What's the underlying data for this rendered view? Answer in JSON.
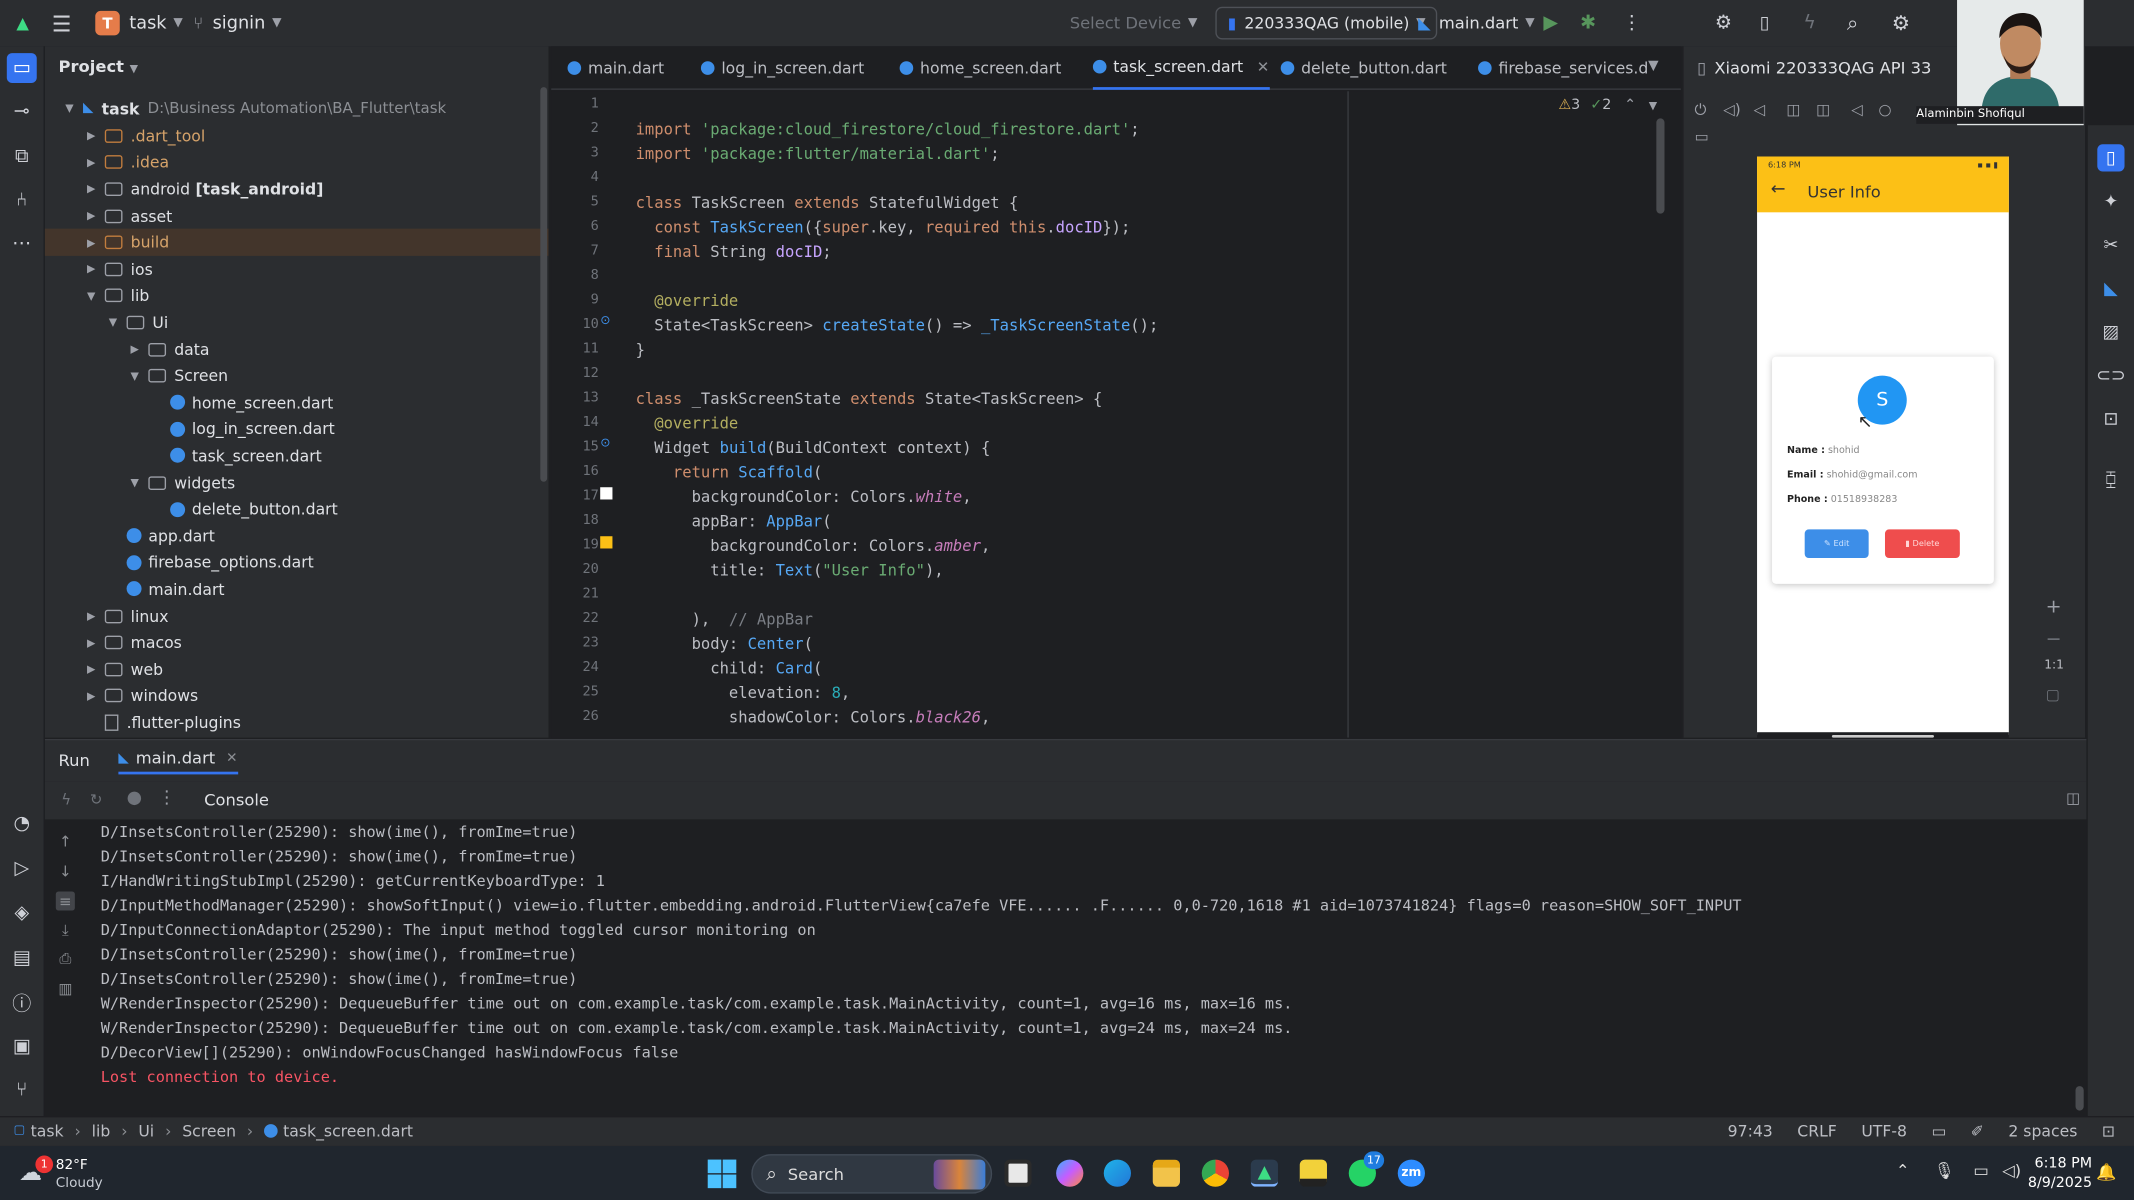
{
  "titlebar": {
    "project_letter": "T",
    "project_name": "task",
    "branch": "signin",
    "select_device": "Select Device",
    "device": "220333QAG (mobile)",
    "run_config": "main.dart"
  },
  "project_panel": {
    "title": "Project",
    "root_name": "task",
    "root_path": "D:\\Business Automation\\BA_Flutter\\task",
    "items": [
      {
        "label": ".dart_tool",
        "type": "folder-orange",
        "level": 1,
        "arrow": "right",
        "hl": false
      },
      {
        "label": ".idea",
        "type": "folder-orange",
        "level": 1,
        "arrow": "right",
        "hl": false
      },
      {
        "label": "android",
        "suffix": "[task_android]",
        "type": "folder",
        "level": 1,
        "arrow": "right",
        "hl": false
      },
      {
        "label": "asset",
        "type": "folder",
        "level": 1,
        "arrow": "right",
        "hl": false
      },
      {
        "label": "build",
        "type": "folder-orange",
        "level": 1,
        "arrow": "right",
        "hl": true
      },
      {
        "label": "ios",
        "type": "folder",
        "level": 1,
        "arrow": "right",
        "hl": false
      },
      {
        "label": "lib",
        "type": "folder",
        "level": 1,
        "arrow": "down",
        "hl": false
      },
      {
        "label": "Ui",
        "type": "folder",
        "level": 2,
        "arrow": "down",
        "hl": false
      },
      {
        "label": "data",
        "type": "folder",
        "level": 3,
        "arrow": "right",
        "hl": false
      },
      {
        "label": "Screen",
        "type": "folder",
        "level": 3,
        "arrow": "down",
        "hl": false
      },
      {
        "label": "home_screen.dart",
        "type": "dart",
        "level": 4,
        "arrow": "",
        "hl": false
      },
      {
        "label": "log_in_screen.dart",
        "type": "dart",
        "level": 4,
        "arrow": "",
        "hl": false
      },
      {
        "label": "task_screen.dart",
        "type": "dart",
        "level": 4,
        "arrow": "",
        "hl": false
      },
      {
        "label": "widgets",
        "type": "folder",
        "level": 3,
        "arrow": "down",
        "hl": false
      },
      {
        "label": "delete_button.dart",
        "type": "dart",
        "level": 4,
        "arrow": "",
        "hl": false
      },
      {
        "label": "app.dart",
        "type": "dart",
        "level": 2,
        "arrow": "",
        "hl": false
      },
      {
        "label": "firebase_options.dart",
        "type": "dart",
        "level": 2,
        "arrow": "",
        "hl": false
      },
      {
        "label": "main.dart",
        "type": "dart",
        "level": 2,
        "arrow": "",
        "hl": false
      },
      {
        "label": "linux",
        "type": "folder",
        "level": 1,
        "arrow": "right",
        "hl": false
      },
      {
        "label": "macos",
        "type": "folder",
        "level": 1,
        "arrow": "right",
        "hl": false
      },
      {
        "label": "web",
        "type": "folder",
        "level": 1,
        "arrow": "right",
        "hl": false
      },
      {
        "label": "windows",
        "type": "folder",
        "level": 1,
        "arrow": "right",
        "hl": false
      },
      {
        "label": ".flutter-plugins",
        "type": "file",
        "level": 1,
        "arrow": "",
        "hl": false
      }
    ]
  },
  "editor_tabs": [
    {
      "label": "main.dart",
      "active": false,
      "closable": false
    },
    {
      "label": "log_in_screen.dart",
      "active": false,
      "closable": false
    },
    {
      "label": "home_screen.dart",
      "active": false,
      "closable": false
    },
    {
      "label": "task_screen.dart",
      "active": true,
      "closable": true
    },
    {
      "label": "delete_button.dart",
      "active": false,
      "closable": false
    },
    {
      "label": "firebase_services.d",
      "active": false,
      "closable": false
    }
  ],
  "inspections": {
    "warnings": "3",
    "checks": "2"
  },
  "code_lines": [
    {
      "n": "1",
      "html": ""
    },
    {
      "n": "2",
      "html": "<span class='kw'>import</span> <span class='str'>'package:cloud_firestore/cloud_firestore.dart'</span>;"
    },
    {
      "n": "3",
      "html": "<span class='kw'>import</span> <span class='str'>'package:flutter/material.dart'</span>;"
    },
    {
      "n": "4",
      "html": ""
    },
    {
      "n": "5",
      "html": "<span class='kw'>class</span> TaskScreen <span class='kw'>extends</span> StatefulWidget {"
    },
    {
      "n": "6",
      "html": "  <span class='kw'>const</span> <span class='fn'>TaskScreen</span>({<span class='kw'>super</span>.key, <span class='kw'>required this</span>.<span class='ty'>docID</span>});"
    },
    {
      "n": "7",
      "html": "  <span class='kw'>final</span> String <span class='ty'>docID</span>;"
    },
    {
      "n": "8",
      "html": ""
    },
    {
      "n": "9",
      "html": "  <span class='ann'>@override</span>"
    },
    {
      "n": "10",
      "html": "  State&lt;TaskScreen&gt; <span class='fn'>createState</span>() =&gt; <span class='fn'>_TaskScreenState</span>();"
    },
    {
      "n": "11",
      "html": "}"
    },
    {
      "n": "12",
      "html": ""
    },
    {
      "n": "13",
      "html": "<span class='kw'>class</span> _TaskScreenState <span class='kw'>extends</span> State&lt;TaskScreen&gt; {"
    },
    {
      "n": "14",
      "html": "  <span class='ann'>@override</span>"
    },
    {
      "n": "15",
      "html": "  Widget <span class='fn'>build</span>(BuildContext context) {"
    },
    {
      "n": "16",
      "html": "    <span class='kw'>return</span> <span class='fn'>Scaffold</span>("
    },
    {
      "n": "17",
      "html": "      backgroundColor: Colors.<span class='it'>white</span>,"
    },
    {
      "n": "18",
      "html": "      appBar: <span class='fn'>AppBar</span>("
    },
    {
      "n": "19",
      "html": "        backgroundColor: Colors.<span class='it'>amber</span>,"
    },
    {
      "n": "20",
      "html": "        title: <span class='fn'>Text</span>(<span class='str'>\"User Info\"</span>),"
    },
    {
      "n": "21",
      "html": ""
    },
    {
      "n": "22",
      "html": "      ),  <span class='cm'>// AppBar</span>"
    },
    {
      "n": "23",
      "html": "      body: <span class='fn'>Center</span>("
    },
    {
      "n": "24",
      "html": "        child: <span class='fn'>Card</span>("
    },
    {
      "n": "25",
      "html": "          elevation: <span class='num'>8</span>,"
    },
    {
      "n": "26",
      "html": "          shadowColor: Colors.<span class='it'>black26</span>,"
    }
  ],
  "device_panel": {
    "title": "Xiaomi 220333QAG API 33",
    "zoom": "1:1"
  },
  "phone": {
    "status_time": "6:18 PM",
    "appbar_title": "User Info",
    "avatar_letter": "S",
    "name_label": "Name :",
    "name_value": "shohid",
    "email_label": "Email :",
    "email_value": "shohid@gmail.com",
    "phone_label": "Phone :",
    "phone_value": "01518938283",
    "edit_label": "Edit",
    "delete_label": "Delete"
  },
  "run_panel": {
    "tab_run": "Run",
    "tab_config": "main.dart",
    "console_label": "Console",
    "logs": [
      {
        "text": "D/InsetsController(25290): show(ime(), fromIme=true)",
        "err": false
      },
      {
        "text": "D/InsetsController(25290): show(ime(), fromIme=true)",
        "err": false
      },
      {
        "text": "I/HandWritingStubImpl(25290): getCurrentKeyboardType: 1",
        "err": false
      },
      {
        "text": "D/InputMethodManager(25290): showSoftInput() view=io.flutter.embedding.android.FlutterView{ca7efe VFE...... .F...... 0,0-720,1618 #1 aid=1073741824} flags=0 reason=SHOW_SOFT_INPUT",
        "err": false
      },
      {
        "text": "D/InputConnectionAdaptor(25290): The input method toggled cursor monitoring on",
        "err": false
      },
      {
        "text": "D/InsetsController(25290): show(ime(), fromIme=true)",
        "err": false
      },
      {
        "text": "D/InsetsController(25290): show(ime(), fromIme=true)",
        "err": false
      },
      {
        "text": "W/RenderInspector(25290): DequeueBuffer time out on com.example.task/com.example.task.MainActivity, count=1, avg=16 ms, max=16 ms.",
        "err": false
      },
      {
        "text": "W/RenderInspector(25290): DequeueBuffer time out on com.example.task/com.example.task.MainActivity, count=1, avg=24 ms, max=24 ms.",
        "err": false
      },
      {
        "text": "D/DecorView[](25290): onWindowFocusChanged hasWindowFocus false",
        "err": false
      },
      {
        "text": "Lost connection to device.",
        "err": true
      }
    ]
  },
  "statusbar": {
    "breadcrumb": [
      "task",
      "lib",
      "Ui",
      "Screen",
      "task_screen.dart"
    ],
    "position": "97:43",
    "line_sep": "CRLF",
    "encoding": "UTF-8",
    "indent": "2 spaces"
  },
  "taskbar": {
    "weather_temp": "82°F",
    "weather_desc": "Cloudy",
    "weather_badge": "1",
    "search_placeholder": "Search",
    "whatsapp_badge": "17",
    "time": "6:18 PM",
    "date": "8/9/2025"
  },
  "webcam": {
    "name": "Alaminbin Shofiqul"
  },
  "colors": {
    "accent": "#3574f0",
    "appbar_amber": "#fcc016",
    "avatar_blue": "#2196f3",
    "delete_red": "#ef4d4d",
    "error_text": "#f75464"
  }
}
